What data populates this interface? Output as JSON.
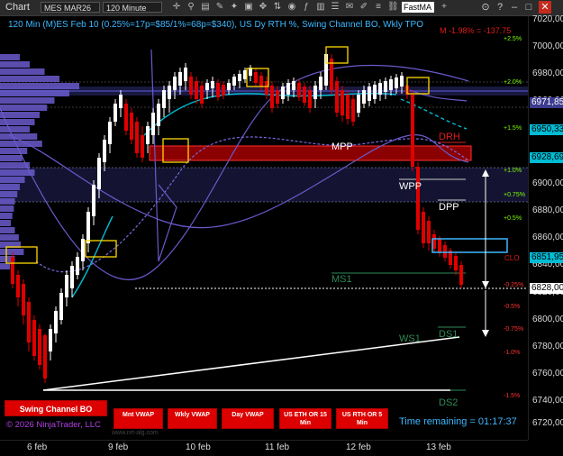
{
  "toolbar": {
    "window_title": "Chart",
    "instrument": "MES MAR26",
    "interval": "120 Minute",
    "search_value": "FastMA"
  },
  "header": {
    "description": "120 Min (M)ES Feb 10 (0.25%=17p=$85/1%=68p=$340), US Dy RTH %, Swing Channel BO, Wkly TPO",
    "pl": "M -1.98% = -137.75"
  },
  "price_axis": {
    "labels": [
      "7020,00",
      "7000,00",
      "6980,00",
      "6960,00",
      "6940,00",
      "6920,00",
      "6900,00",
      "6880,00",
      "6860,00",
      "6840,00",
      "6820,00",
      "6800,00",
      "6780,00",
      "6760,00",
      "6740,00",
      "6720,00"
    ],
    "tags": [
      {
        "text": "6971,85",
        "bg": "#3b3b8f",
        "fg": "#ffffff"
      },
      {
        "text": "6950,33",
        "bg": "#00bcd4",
        "fg": "#000000"
      },
      {
        "text": "6928,69",
        "bg": "#00bcd4",
        "fg": "#000000"
      },
      {
        "text": "6851,95",
        "bg": "#00bcd4",
        "fg": "#000000"
      },
      {
        "text": "6828,00",
        "bg": "#ffffff",
        "fg": "#000000"
      }
    ]
  },
  "time_axis": {
    "labels": [
      "6 feb",
      "9 feb",
      "10 feb",
      "11 feb",
      "12 feb",
      "13 feb"
    ]
  },
  "levels": {
    "mpp": "MPP",
    "wpp": "WPP",
    "dpp": "DPP",
    "drh": "DRH",
    "ms1": "MS1",
    "ws1": "WS1",
    "ds1": "DS1",
    "ds2": "DS2",
    "clo": "CLO"
  },
  "percent_marks": [
    {
      "text": "+2.5%",
      "color": "#7cfc00"
    },
    {
      "text": "+2.0%",
      "color": "#7cfc00"
    },
    {
      "text": "+1.5%",
      "color": "#7cfc00"
    },
    {
      "text": "+1.0%",
      "color": "#7cfc00"
    },
    {
      "text": "+0.75%",
      "color": "#7cfc00"
    },
    {
      "text": "+0.5%",
      "color": "#7cfc00"
    },
    {
      "text": "-0.25%",
      "color": "#ff3030"
    },
    {
      "text": "-0.5%",
      "color": "#ff3030"
    },
    {
      "text": "-0.75%",
      "color": "#ff3030"
    },
    {
      "text": "-1.0%",
      "color": "#ff3030"
    },
    {
      "text": "-1.5%",
      "color": "#ff3030"
    }
  ],
  "buttons": {
    "swing_channel": "Swing Channel BO",
    "mnt_vwap": "Mnt VWAP",
    "wkly_vwap": "Wkly VWAP",
    "day_vwap": "Day VWAP",
    "us_eth": "US ETH OR 15 Min",
    "us_rth": "US RTH OR 5 Min"
  },
  "footer": {
    "copyright": "© 2026 NinjaTrader, LLC",
    "time_remaining": "Time remaining = 01:17:37",
    "watermark": "www.nrt-alg.com"
  },
  "colors": {
    "accent": "#3db8ff",
    "up_candle": "#ffffff",
    "down_candle": "#e00000",
    "profile": "#6a5acd"
  }
}
